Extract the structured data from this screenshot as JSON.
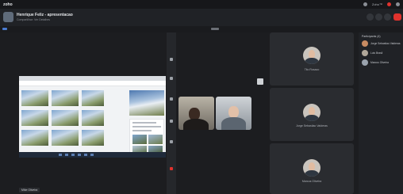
{
  "app": {
    "brand": "zoho",
    "top_right_status": "Zoho™"
  },
  "meeting": {
    "title": "Henrique Feliz - apresentacao",
    "subtitle": "Compartilhar: Ver Detalhes"
  },
  "shared_screen": {
    "presenter_label": "Mike Oliveira"
  },
  "participants_panel": {
    "heading": "Participants (4)",
    "items": [
      {
        "name": "Jorge Sebastiao Valderas"
      },
      {
        "name": "Luis Brasil"
      },
      {
        "name": "Marcus Oliveira"
      }
    ]
  },
  "tiles": [
    {
      "name": "Tito Rosaco"
    },
    {
      "name": "Jorge Sebastiao Valderas"
    },
    {
      "name": "Marcus Oliveira"
    }
  ],
  "colors": {
    "accent_red": "#e0322d",
    "bg": "#1c1d20"
  }
}
